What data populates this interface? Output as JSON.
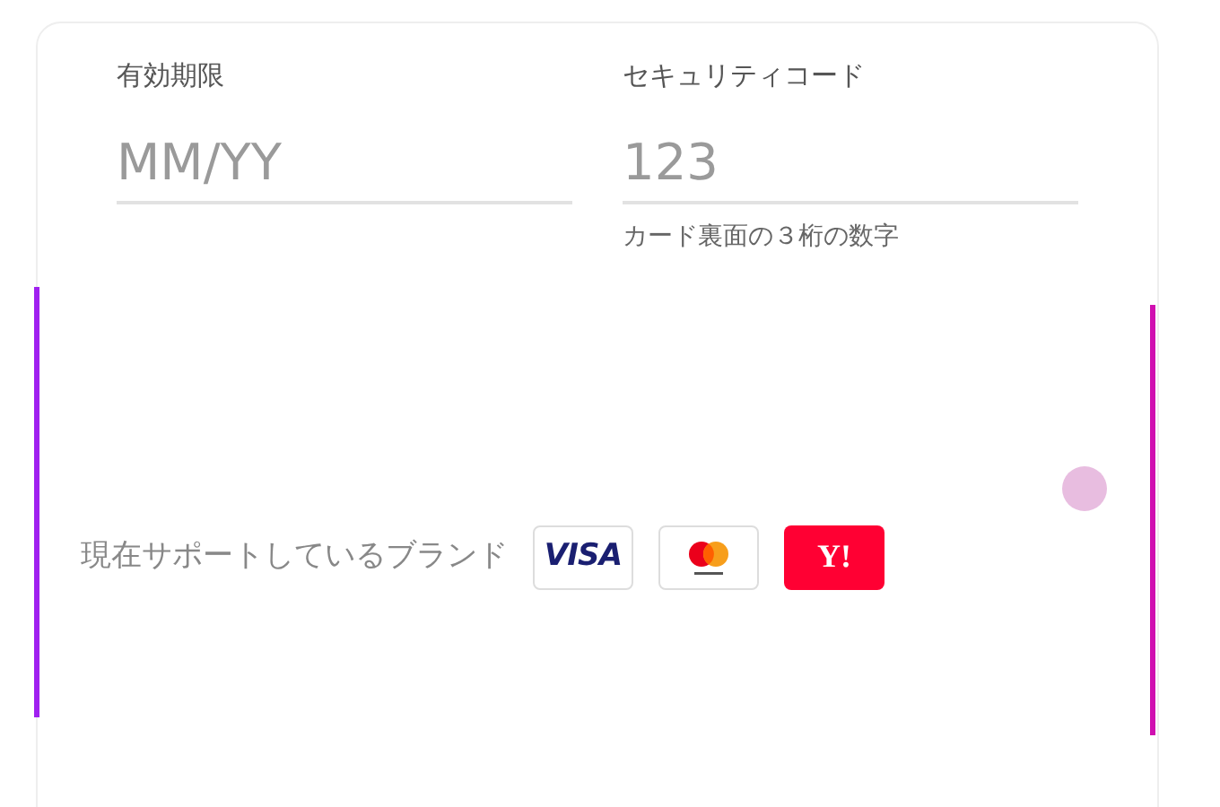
{
  "expiry": {
    "label": "有効期限",
    "placeholder": "MM/YY"
  },
  "security_code": {
    "label": "セキュリティコード",
    "placeholder": "123",
    "hint": "カード裏面の３桁の数字"
  },
  "brands": {
    "label": "現在サポートしているブランド",
    "items": [
      {
        "kind": "visa",
        "label": "VISA"
      },
      {
        "kind": "mastercard"
      },
      {
        "kind": "yahoo",
        "label": "Y!"
      }
    ]
  }
}
